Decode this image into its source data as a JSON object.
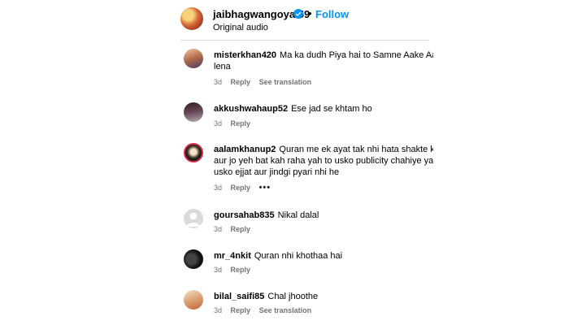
{
  "post": {
    "username": "jaibhagwangoyal59",
    "dot": "•",
    "follow_label": "Follow",
    "audio": "Original audio"
  },
  "comments": [
    {
      "user": "misterkhan420",
      "lines": [
        "Ma ka dudh Piya hai to Samne Aake Aaj",
        "lena"
      ],
      "time": "3d",
      "reply": "Reply",
      "translation": "See translation"
    },
    {
      "user": "akkushwahaup52",
      "lines": [
        "Ese jad se khtam ho"
      ],
      "time": "3d",
      "reply": "Reply"
    },
    {
      "user": "aalamkhanup2",
      "lines": [
        "Quran me ek ayat tak nhi hata shakte kc",
        "aur jo yeh bat kah raha yah to usko publicity chahiye yah",
        "usko ejjat aur jindgi pyari nhi he"
      ],
      "time": "3d",
      "reply": "Reply",
      "more": "•••"
    },
    {
      "user": "goursahab835",
      "lines": [
        "Nikal dalal"
      ],
      "time": "3d",
      "reply": "Reply"
    },
    {
      "user": "mr_4nkit",
      "lines": [
        "Quran nhi khothaa hai"
      ],
      "time": "3d",
      "reply": "Reply"
    },
    {
      "user": "bilal_saifi85",
      "lines": [
        "Chal jhoothe"
      ],
      "time": "3d",
      "reply": "Reply",
      "translation": "See translation"
    }
  ]
}
